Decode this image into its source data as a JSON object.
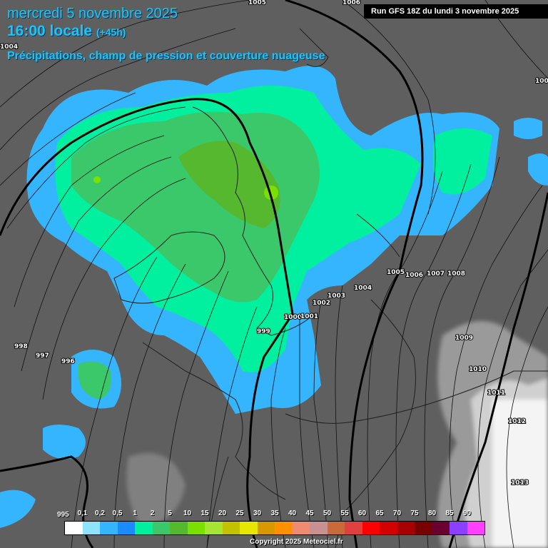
{
  "header": {
    "date_line": "mercredi 5 novembre 2025",
    "time_line": "16:00 locale",
    "offset": "(+45h)",
    "subtitle": "Précipitations, champ de pression et couverture nuageuse"
  },
  "run_banner": "Run GFS 18Z du lundi 3 novembre 2025",
  "copyright": "Copyright 2025 Meteociel.fr",
  "isobar_labels": [
    {
      "text": "1005"
    },
    {
      "text": "1006"
    },
    {
      "text": "1004"
    },
    {
      "text": "100"
    },
    {
      "text": "1005"
    },
    {
      "text": "1006"
    },
    {
      "text": "1007"
    },
    {
      "text": "1008"
    },
    {
      "text": "1004"
    },
    {
      "text": "1003"
    },
    {
      "text": "1002"
    },
    {
      "text": "1000"
    },
    {
      "text": "1001"
    },
    {
      "text": "999"
    },
    {
      "text": "998"
    },
    {
      "text": "997"
    },
    {
      "text": "996"
    },
    {
      "text": "1009"
    },
    {
      "text": "1010"
    },
    {
      "text": "1011"
    },
    {
      "text": "1012"
    },
    {
      "text": "1013"
    }
  ],
  "legend": {
    "label_995": "995",
    "labels": [
      "0,1",
      "0,2",
      "0,5",
      "1",
      "2",
      "5",
      "10",
      "15",
      "20",
      "25",
      "30",
      "35",
      "40",
      "45",
      "50",
      "55",
      "60",
      "65",
      "70",
      "75",
      "80",
      "85",
      "90"
    ],
    "colors": [
      "#ffffff",
      "#8fe3ff",
      "#36b5ff",
      "#1a8cff",
      "#00f0a0",
      "#3ac86a",
      "#55b82e",
      "#79e000",
      "#a6e632",
      "#c2c200",
      "#e6e600",
      "#d89800",
      "#ff9000",
      "#f08a70",
      "#c89090",
      "#c86a3a",
      "#e04040",
      "#ff0000",
      "#d40000",
      "#a80000",
      "#780000",
      "#6a0030",
      "#8c40ff",
      "#ff40ff"
    ]
  }
}
